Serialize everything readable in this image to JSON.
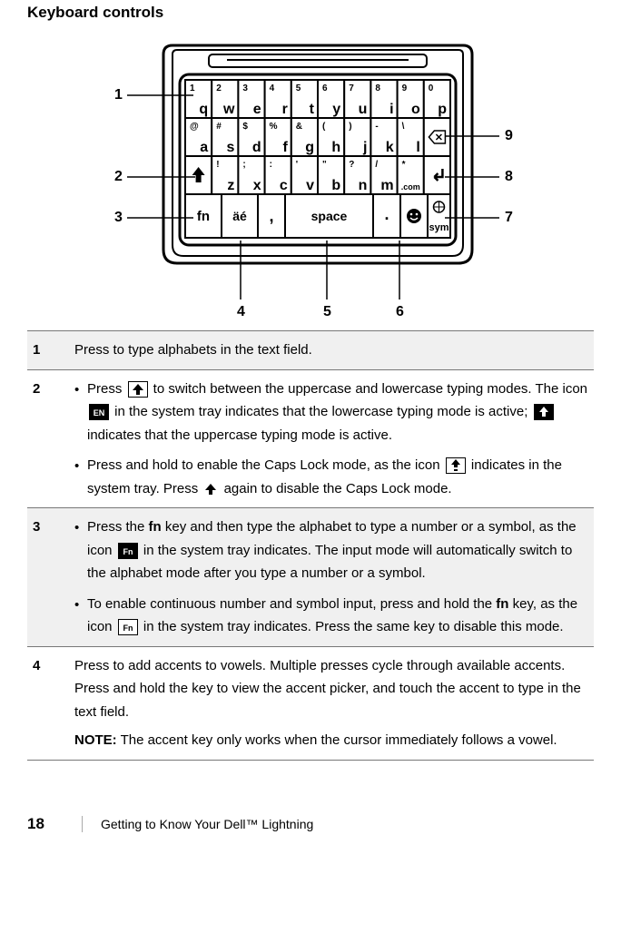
{
  "heading": "Keyboard controls",
  "diagram": {
    "callouts": [
      "1",
      "2",
      "3",
      "4",
      "5",
      "6",
      "7",
      "8",
      "9"
    ],
    "keys_row1": [
      {
        "top": "1",
        "main": "q"
      },
      {
        "top": "2",
        "main": "w"
      },
      {
        "top": "3",
        "main": "e"
      },
      {
        "top": "4",
        "main": "r"
      },
      {
        "top": "5",
        "main": "t"
      },
      {
        "top": "6",
        "main": "y"
      },
      {
        "top": "7",
        "main": "u"
      },
      {
        "top": "8",
        "main": "i"
      },
      {
        "top": "9",
        "main": "o"
      },
      {
        "top": "0",
        "main": "p"
      }
    ],
    "keys_row2": [
      {
        "top": "@",
        "main": "a"
      },
      {
        "top": "#",
        "main": "s"
      },
      {
        "top": "$",
        "main": "d"
      },
      {
        "top": "%",
        "main": "f"
      },
      {
        "top": "&",
        "main": "g"
      },
      {
        "top": "(",
        "main": "h"
      },
      {
        "top": ")",
        "main": "j"
      },
      {
        "top": "-",
        "main": "k"
      },
      {
        "top": "\\",
        "main": "l"
      }
    ],
    "keys_row3": [
      {
        "top": "!",
        "main": "z"
      },
      {
        "top": ";",
        "main": "x"
      },
      {
        "top": ":",
        "main": "c"
      },
      {
        "top": "'",
        "main": "v"
      },
      {
        "top": "\"",
        "main": "b"
      },
      {
        "top": "?",
        "main": "n"
      },
      {
        "top": "/",
        "main": "m"
      },
      {
        "top": "*",
        "main": ".com"
      }
    ],
    "row4": {
      "fn": "fn",
      "accent": "äé",
      "comma": ",",
      "space": "space",
      "period": ".",
      "sym": "sym"
    }
  },
  "rows": {
    "r1": {
      "num": "1",
      "text": "Press to type alphabets in the text field."
    },
    "r2": {
      "num": "2",
      "b1a": "Press ",
      "b1b": " to switch between the uppercase and lowercase typing modes. The icon ",
      "b1c": " in the system tray indicates that the lowercase typing mode is active; ",
      "b1d": " indicates that the uppercase typing mode is active.",
      "b2a": "Press and hold to enable the Caps Lock mode, as the icon ",
      "b2b": " indicates in the system tray. Press ",
      "b2c": " again to disable the Caps Lock mode."
    },
    "r3": {
      "num": "3",
      "b1a": "Press the ",
      "fn": "fn",
      "b1b": " key and then type the alphabet to type a number or a symbol, as the icon ",
      "b1c": " in the system tray indicates. The input mode will automatically switch to the alphabet mode after you type a number or a symbol.",
      "b2a": "To enable continuous number and symbol input, press and hold the ",
      "b2b": " key, as the icon ",
      "b2c": " in the system tray indicates. Press the same key to disable this mode."
    },
    "r4": {
      "num": "4",
      "text": "Press to add accents to vowels. Multiple presses cycle through available accents. Press and hold the key to view the accent picker, and touch the accent to type in the text field.",
      "note_label": "NOTE:",
      "note_text": " The accent key only works when the cursor immediately follows a vowel."
    }
  },
  "footer": {
    "page": "18",
    "title": "Getting to Know Your Dell™ Lightning"
  }
}
